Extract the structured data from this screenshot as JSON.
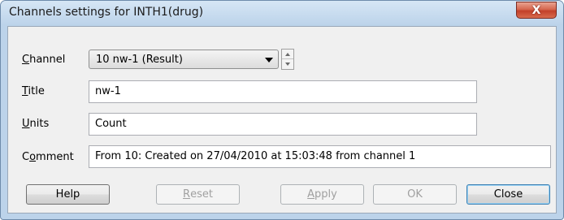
{
  "window": {
    "title": "Channels settings for INTH1(drug)",
    "close_glyph": "X"
  },
  "form": {
    "channel": {
      "label_u": "C",
      "label_rest": "hannel",
      "value": "10 nw-1 (Result)"
    },
    "title": {
      "label_u": "T",
      "label_rest": "itle",
      "value": "nw-1"
    },
    "units": {
      "label_u": "U",
      "label_rest": "nits",
      "value": "Count"
    },
    "comment": {
      "label_pre": "C",
      "label_u": "o",
      "label_rest": "mment",
      "value": "From 10: Created on 27/04/2010 at 15:03:48 from channel 1"
    }
  },
  "buttons": {
    "help": "Help",
    "reset_u": "R",
    "reset_rest": "eset",
    "apply_u": "A",
    "apply_rest": "pply",
    "ok": "OK",
    "close": "Close"
  }
}
